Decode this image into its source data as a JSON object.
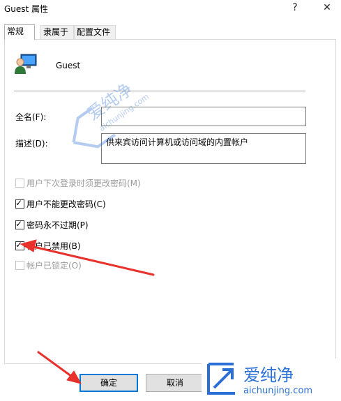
{
  "window": {
    "title": "Guest 属性",
    "help_btn": "?",
    "close_btn": "✕"
  },
  "tabs": [
    {
      "label": "常规",
      "active": true
    },
    {
      "label": "隶属于",
      "active": false
    },
    {
      "label": "配置文件",
      "active": false
    }
  ],
  "user": {
    "name": "Guest"
  },
  "form": {
    "fullname_label": "全名(F):",
    "fullname_value": "",
    "desc_label": "描述(D):",
    "desc_value": "供来宾访问计算机或访问域的内置帐户"
  },
  "checkboxes": [
    {
      "label": "用户下次登录时须更改密码(M)",
      "checked": false,
      "disabled": true
    },
    {
      "label": "用户不能更改密码(C)",
      "checked": true,
      "disabled": false
    },
    {
      "label": "密码永不过期(P)",
      "checked": true,
      "disabled": false
    },
    {
      "label": "帐户已禁用(B)",
      "checked": true,
      "disabled": false
    },
    {
      "label": "帐户已锁定(O)",
      "checked": false,
      "disabled": true
    }
  ],
  "buttons": {
    "ok": "确定",
    "cancel": "取消"
  },
  "watermark": {
    "brand_cn": "爱纯净",
    "brand_url": "aichunjing.com"
  },
  "colors": {
    "accent": "#0078d7",
    "arrow": "#e8312a",
    "watermark": "#2a6fd6"
  }
}
